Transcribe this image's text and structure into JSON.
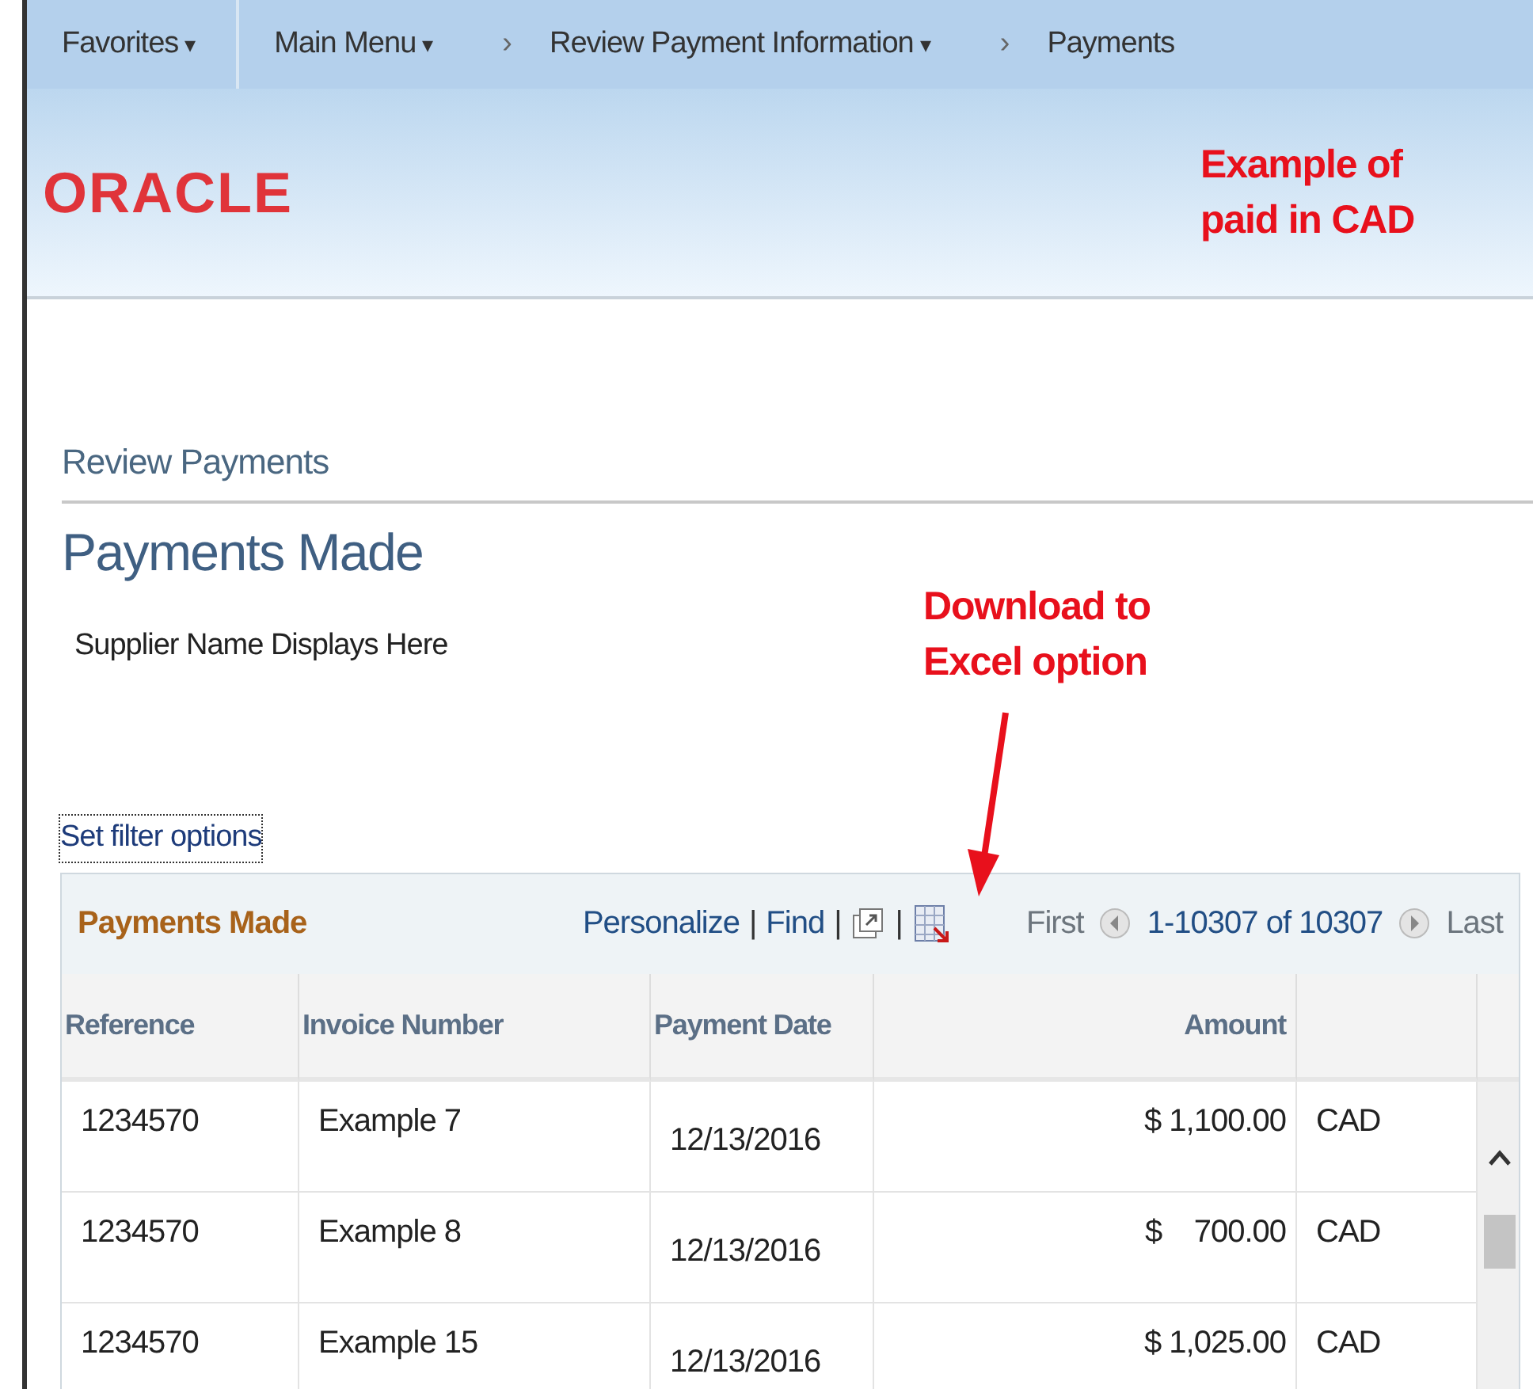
{
  "nav": {
    "items": [
      {
        "label": "Favorites",
        "caret": "▾"
      },
      {
        "label": "Main Menu",
        "caret": "▾"
      },
      {
        "separator": "›",
        "label": "Review Payment Information",
        "caret": "▾"
      },
      {
        "separator": "›",
        "label": "Payments"
      }
    ]
  },
  "header": {
    "logo": "ORACLE",
    "note": "Example of paid in CAD"
  },
  "page": {
    "breadcrumb_title": "Review Payments",
    "title": "Payments Made",
    "supplier": "Supplier Name Displays Here"
  },
  "annotation": {
    "text": "Download to Excel option"
  },
  "filter_link": "Set filter options",
  "grid": {
    "title": "Payments Made",
    "toolbar": [
      {
        "kind": "link",
        "label": "Personalize"
      },
      {
        "kind": "sep",
        "label": "|"
      },
      {
        "kind": "link",
        "label": "Find"
      },
      {
        "kind": "sep",
        "label": "|"
      },
      {
        "kind": "zoom"
      },
      {
        "kind": "sep",
        "label": "|"
      },
      {
        "kind": "excel"
      }
    ],
    "pager": {
      "first": "First",
      "range": "1-10307 of 10307",
      "last": "Last"
    },
    "columns": [
      "Reference",
      "Invoice Number",
      "Payment Date",
      "Amount"
    ],
    "rows": [
      {
        "reference": "1234570",
        "invoice": "Example 7",
        "date": "12/13/2016",
        "amount": "$ 1,100.00",
        "currency": "CAD"
      },
      {
        "reference": "1234570",
        "invoice": "Example 8",
        "date": "12/13/2016",
        "amount": "$    700.00",
        "currency": "CAD"
      },
      {
        "reference": "1234570",
        "invoice": "Example 15",
        "date": "12/13/2016",
        "amount": "$ 1,025.00",
        "currency": "CAD"
      }
    ]
  }
}
